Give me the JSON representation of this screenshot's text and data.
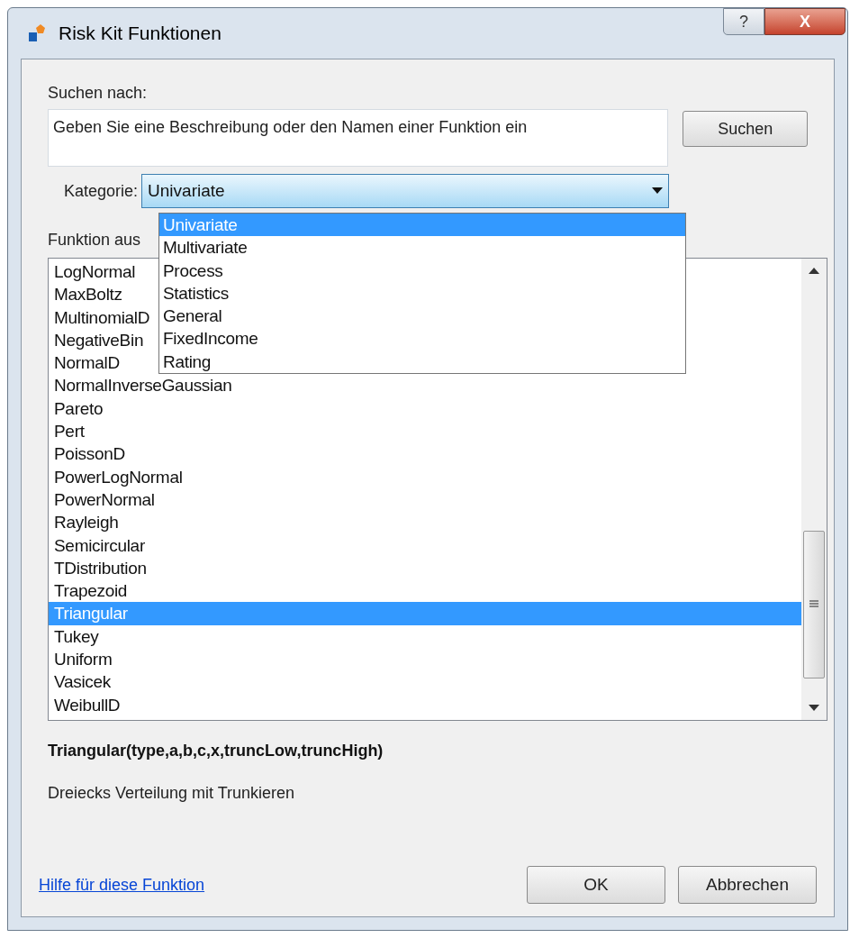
{
  "window": {
    "title": "Risk Kit Funktionen",
    "buttons": [
      "?",
      "X"
    ]
  },
  "search": {
    "label": "Suchen nach:",
    "placeholder": "Geben Sie eine Beschreibung oder den Namen einer Funktion ein",
    "button": "Suchen"
  },
  "category": {
    "label": "Kategorie:",
    "value": "Univariate",
    "expanded": true,
    "options": [
      {
        "label": "Univariate",
        "selected": true
      },
      {
        "label": "Multivariate",
        "selected": false
      },
      {
        "label": "Process",
        "selected": false
      },
      {
        "label": "Statistics",
        "selected": false
      },
      {
        "label": "General",
        "selected": false
      },
      {
        "label": "FixedIncome",
        "selected": false
      },
      {
        "label": "Rating",
        "selected": false
      }
    ]
  },
  "function_list": {
    "label": "Funktion aus",
    "items": [
      {
        "label": "LogNormal",
        "selected": false
      },
      {
        "label": "MaxBoltz",
        "selected": false
      },
      {
        "label": "MultinomialD",
        "selected": false
      },
      {
        "label": "NegativeBin",
        "selected": false
      },
      {
        "label": "NormalD",
        "selected": false
      },
      {
        "label": "NormalInverseGaussian",
        "selected": false
      },
      {
        "label": "Pareto",
        "selected": false
      },
      {
        "label": "Pert",
        "selected": false
      },
      {
        "label": "PoissonD",
        "selected": false
      },
      {
        "label": "PowerLogNormal",
        "selected": false
      },
      {
        "label": "PowerNormal",
        "selected": false
      },
      {
        "label": "Rayleigh",
        "selected": false
      },
      {
        "label": "Semicircular",
        "selected": false
      },
      {
        "label": "TDistribution",
        "selected": false
      },
      {
        "label": "Trapezoid",
        "selected": false
      },
      {
        "label": "Triangular",
        "selected": true
      },
      {
        "label": "Tukey",
        "selected": false
      },
      {
        "label": "Uniform",
        "selected": false
      },
      {
        "label": "Vasicek",
        "selected": false
      },
      {
        "label": "WeibullD",
        "selected": false
      }
    ]
  },
  "signature": "Triangular(type,a,b,c,x,truncLow,truncHigh)",
  "description": "Dreiecks Verteilung mit Trunkieren",
  "help_link": "Hilfe für diese Funktion",
  "buttons": [
    "OK",
    "Abbrechen"
  ]
}
